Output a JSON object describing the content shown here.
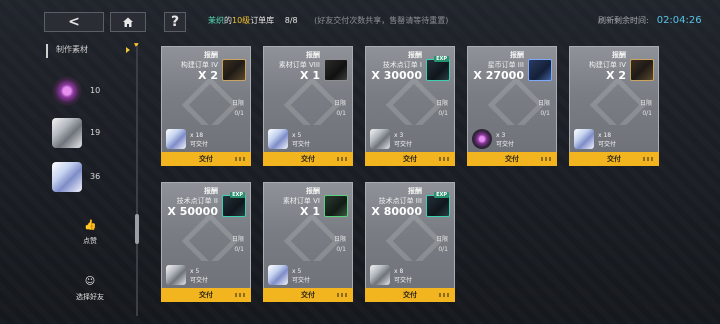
{
  "header": {
    "back_label": "<",
    "help_label": "?",
    "owner": "茉织",
    "possessive": "的",
    "level": "10级",
    "library": "订单库",
    "count": "8/8",
    "note": "(好友交付次数共享，售罄请等待重置)",
    "refresh_label": "刷新剩余时间:",
    "refresh_time": "02:04:26"
  },
  "sidebar": {
    "title": "制作素材",
    "materials": [
      {
        "icon": "orb-material-icon",
        "count": "10"
      },
      {
        "icon": "crystal-material-icon",
        "count": "19"
      },
      {
        "icon": "cube-material-icon",
        "count": "36"
      }
    ],
    "like_label": "点赞",
    "select_friend_label": "选择好友"
  },
  "cards": [
    {
      "tag": "报酬",
      "name": "构建订单 IV",
      "qty": "X 2",
      "item": "doc",
      "badge": "",
      "limit_label": "日限",
      "limit": "0/1",
      "req_icon": "cube",
      "req_count": "x 18",
      "req_label": "可交付",
      "button": "交付"
    },
    {
      "tag": "报酬",
      "name": "素材订单 VIII",
      "qty": "X 1",
      "item": "doc2",
      "badge": "",
      "limit_label": "日限",
      "limit": "0/1",
      "req_icon": "cube",
      "req_count": "x 5",
      "req_label": "可交付",
      "button": "交付"
    },
    {
      "tag": "报酬",
      "name": "技术点订单 I",
      "qty": "X 30000",
      "item": "exp",
      "badge": "EXP",
      "limit_label": "日限",
      "limit": "0/1",
      "req_icon": "crystal",
      "req_count": "x 3",
      "req_label": "可交付",
      "button": "交付"
    },
    {
      "tag": "报酬",
      "name": "星币订单 III",
      "qty": "X 27000",
      "item": "coin",
      "badge": "",
      "limit_label": "日限",
      "limit": "0/1",
      "req_icon": "orb",
      "req_count": "x 3",
      "req_label": "可交付",
      "button": "交付"
    },
    {
      "tag": "报酬",
      "name": "构建订单 IV",
      "qty": "X 2",
      "item": "doc",
      "badge": "",
      "limit_label": "日限",
      "limit": "0/1",
      "req_icon": "cube",
      "req_count": "x 18",
      "req_label": "可交付",
      "button": "交付"
    },
    {
      "tag": "报酬",
      "name": "技术点订单 II",
      "qty": "X 50000",
      "item": "exp",
      "badge": "EXP",
      "limit_label": "日限",
      "limit": "0/1",
      "req_icon": "crystal",
      "req_count": "x 5",
      "req_label": "可交付",
      "button": "交付"
    },
    {
      "tag": "报酬",
      "name": "素材订单 VI",
      "qty": "X 1",
      "item": "ticket",
      "badge": "",
      "limit_label": "日限",
      "limit": "0/1",
      "req_icon": "cube",
      "req_count": "x 5",
      "req_label": "可交付",
      "button": "交付"
    },
    {
      "tag": "报酬",
      "name": "技术点订单 III",
      "qty": "X 80000",
      "item": "exp",
      "badge": "EXP",
      "limit_label": "日限",
      "limit": "0/1",
      "req_icon": "crystal",
      "req_count": "x 8",
      "req_label": "可交付",
      "button": "交付"
    }
  ]
}
